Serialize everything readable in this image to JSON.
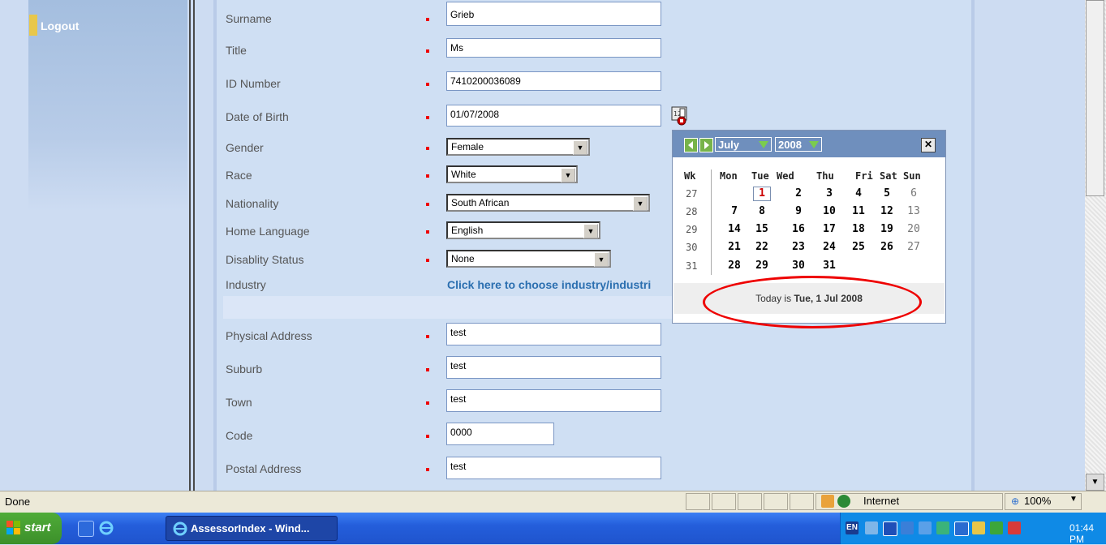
{
  "nav": {
    "logout_label": "Logout"
  },
  "form": {
    "fields": {
      "surname": {
        "label": "Surname",
        "value": "Grieb"
      },
      "title": {
        "label": "Title",
        "value": "Ms"
      },
      "id_number": {
        "label": "ID Number",
        "value": "7410200036089"
      },
      "dob": {
        "label": "Date of Birth",
        "value": "01/07/2008"
      },
      "gender": {
        "label": "Gender",
        "value": "Female"
      },
      "race": {
        "label": "Race",
        "value": "White"
      },
      "nationality": {
        "label": "Nationality",
        "value": "South African"
      },
      "home_language": {
        "label": "Home Language",
        "value": "English"
      },
      "disability": {
        "label": "Disablity Status",
        "value": "None"
      },
      "industry": {
        "label": "Industry",
        "link": "Click here to choose industry/industri"
      },
      "physical_address": {
        "label": "Physical Address",
        "value": "test"
      },
      "suburb": {
        "label": "Suburb",
        "value": "test"
      },
      "town": {
        "label": "Town",
        "value": "test"
      },
      "code": {
        "label": "Code",
        "value": "0000"
      },
      "postal_address": {
        "label": "Postal Address",
        "value": "test"
      }
    }
  },
  "calendar": {
    "month": "July",
    "year": "2008",
    "close": "✕",
    "headers": {
      "wk": "Wk",
      "mon": "Mon",
      "tue": "Tue",
      "wed": "Wed",
      "thu": "Thu",
      "fri": "Fri",
      "sat": "Sat",
      "sun": "Sun"
    },
    "weeks": [
      {
        "wk": "27",
        "days": [
          "",
          "1",
          "2",
          "3",
          "4",
          "5",
          "6"
        ]
      },
      {
        "wk": "28",
        "days": [
          "7",
          "8",
          "9",
          "10",
          "11",
          "12",
          "13"
        ]
      },
      {
        "wk": "29",
        "days": [
          "14",
          "15",
          "16",
          "17",
          "18",
          "19",
          "20"
        ]
      },
      {
        "wk": "30",
        "days": [
          "21",
          "22",
          "23",
          "24",
          "25",
          "26",
          "27"
        ]
      },
      {
        "wk": "31",
        "days": [
          "28",
          "29",
          "30",
          "31",
          "",
          "",
          ""
        ]
      }
    ],
    "today_prefix": "Today is ",
    "today_date": "Tue, 1 Jul 2008"
  },
  "statusbar": {
    "text": "Done",
    "zone": "Internet",
    "zoom": "100%"
  },
  "taskbar": {
    "start_label": "start",
    "window_label": "AssessorIndex - Wind...",
    "clock": "01:44 PM",
    "lang": "EN"
  },
  "colors": {
    "highlight_ellipse": "#e00000",
    "today": "#cc0000",
    "link": "#2b6fb0"
  }
}
